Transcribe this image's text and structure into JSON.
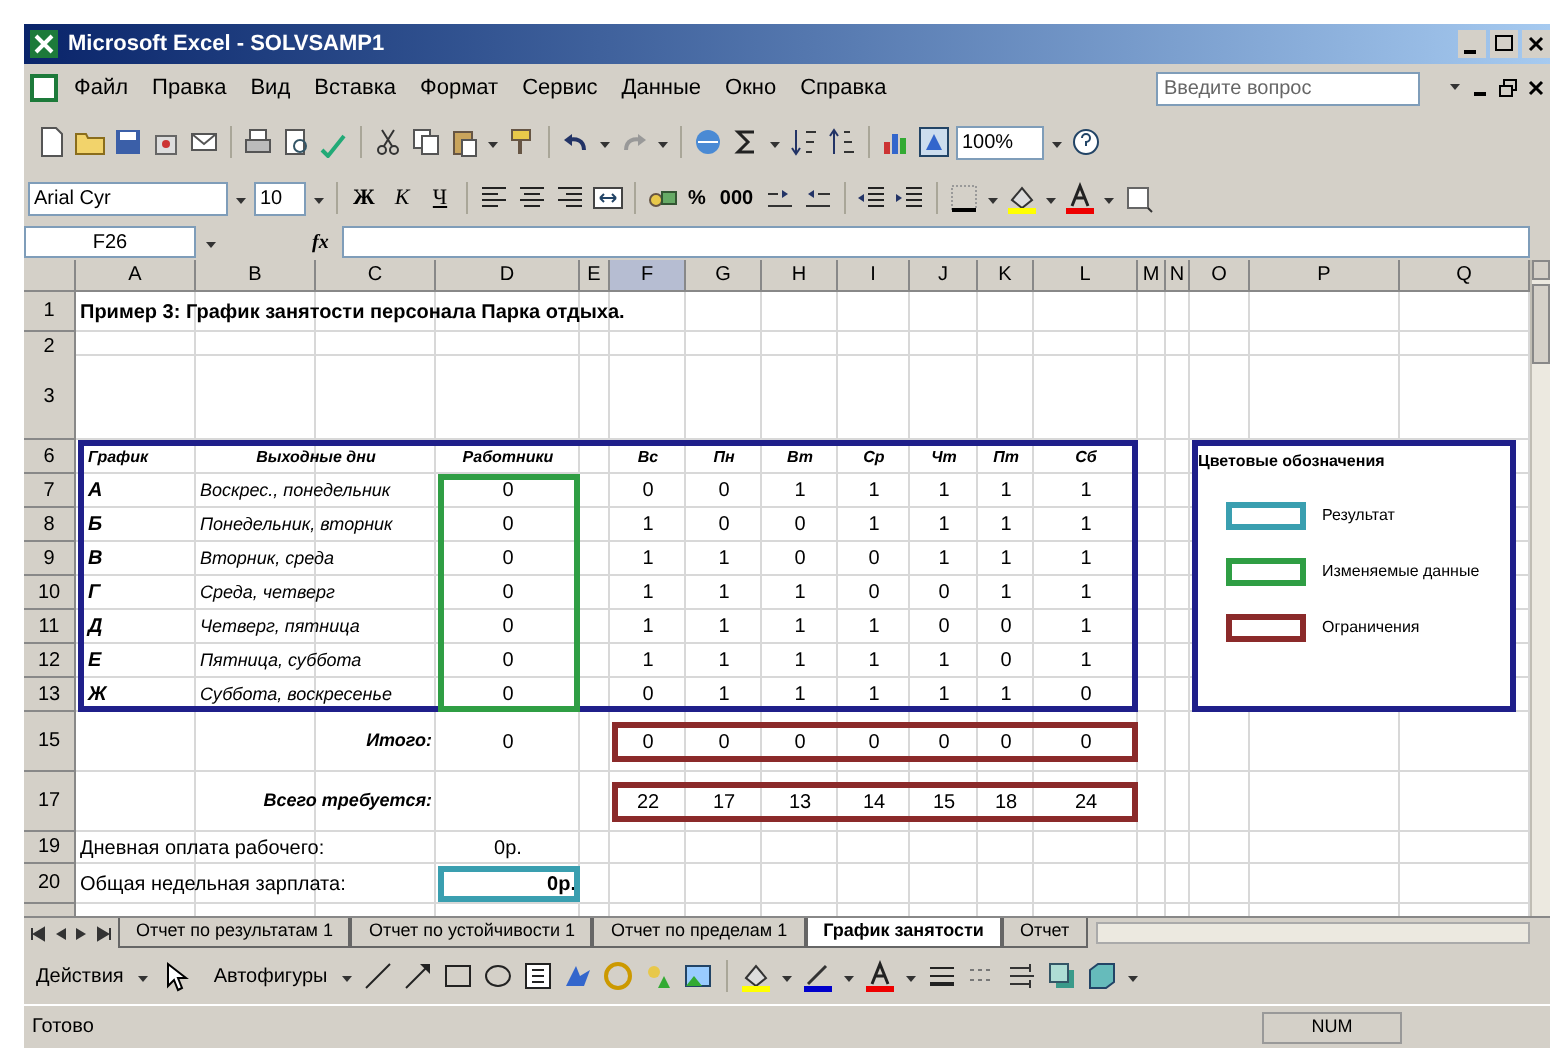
{
  "window": {
    "title": "Microsoft Excel - SOLVSAMP1"
  },
  "menu": [
    "Файл",
    "Правка",
    "Вид",
    "Вставка",
    "Формат",
    "Сервис",
    "Данные",
    "Окно",
    "Справка"
  ],
  "help_search": {
    "placeholder": "Введите вопрос"
  },
  "standard_toolbar": {
    "zoom": "100%"
  },
  "formatting_toolbar": {
    "font": "Arial Cyr",
    "size": "10",
    "style_buttons": [
      "Ж",
      "К",
      "Ч"
    ],
    "number_buttons": [
      "%",
      "000"
    ]
  },
  "formula_bar": {
    "name_box": "F26",
    "function_button": "fx"
  },
  "columns": [
    {
      "label": "A",
      "selected": false
    },
    {
      "label": "B",
      "selected": false
    },
    {
      "label": "C",
      "selected": false
    },
    {
      "label": "D",
      "selected": false
    },
    {
      "label": "E",
      "selected": false
    },
    {
      "label": "F",
      "selected": true
    },
    {
      "label": "G",
      "selected": false
    },
    {
      "label": "H",
      "selected": false
    },
    {
      "label": "I",
      "selected": false
    },
    {
      "label": "J",
      "selected": false
    },
    {
      "label": "K",
      "selected": false
    },
    {
      "label": "L",
      "selected": false
    },
    {
      "label": "M",
      "selected": false
    },
    {
      "label": "N",
      "selected": false
    },
    {
      "label": "O",
      "selected": false
    },
    {
      "label": "P",
      "selected": false
    },
    {
      "label": "Q",
      "selected": false
    }
  ],
  "title_row": {
    "row": "1",
    "text": "Пример 3:  График занятости персонала Парка отдыха."
  },
  "empty_rows": [
    "2",
    "3"
  ],
  "schedule": {
    "header_row": "6",
    "headers": [
      "График",
      "Выходные дни",
      "Работники"
    ],
    "days": [
      "Вс",
      "Пн",
      "Вт",
      "Ср",
      "Чт",
      "Пт",
      "Сб"
    ],
    "rows": [
      {
        "row": "7",
        "schedule": "А",
        "days_off": "Воскрес., понедельник",
        "workers": "0",
        "values": [
          "0",
          "0",
          "1",
          "1",
          "1",
          "1",
          "1"
        ]
      },
      {
        "row": "8",
        "schedule": "Б",
        "days_off": "Понедельник, вторник",
        "workers": "0",
        "values": [
          "1",
          "0",
          "0",
          "1",
          "1",
          "1",
          "1"
        ]
      },
      {
        "row": "9",
        "schedule": "В",
        "days_off": "Вторник, среда",
        "workers": "0",
        "values": [
          "1",
          "1",
          "0",
          "0",
          "1",
          "1",
          "1"
        ]
      },
      {
        "row": "10",
        "schedule": "Г",
        "days_off": "Среда, четверг",
        "workers": "0",
        "values": [
          "1",
          "1",
          "1",
          "0",
          "0",
          "1",
          "1"
        ]
      },
      {
        "row": "11",
        "schedule": "Д",
        "days_off": "Четверг, пятница",
        "workers": "0",
        "values": [
          "1",
          "1",
          "1",
          "1",
          "0",
          "0",
          "1"
        ]
      },
      {
        "row": "12",
        "schedule": "Е",
        "days_off": "Пятница, суббота",
        "workers": "0",
        "values": [
          "1",
          "1",
          "1",
          "1",
          "1",
          "0",
          "1"
        ]
      },
      {
        "row": "13",
        "schedule": "Ж",
        "days_off": "Суббота, воскресенье",
        "workers": "0",
        "values": [
          "0",
          "1",
          "1",
          "1",
          "1",
          "1",
          "0"
        ]
      }
    ]
  },
  "totals": {
    "row": "15",
    "label": "Итого:",
    "workers": "0",
    "values": [
      "0",
      "0",
      "0",
      "0",
      "0",
      "0",
      "0"
    ]
  },
  "required": {
    "row": "17",
    "label": "Всего требуется:",
    "values": [
      "22",
      "17",
      "13",
      "14",
      "15",
      "18",
      "24"
    ]
  },
  "daily_pay": {
    "row": "19",
    "label": "Дневная оплата рабочего:",
    "value": "0р."
  },
  "weekly_pay": {
    "row": "20",
    "label": "Общая недельная зарплата:",
    "value": "0р."
  },
  "legend": {
    "title": "Цветовые обозначения",
    "items": [
      {
        "label": "Результат",
        "color": "#3a9fb0"
      },
      {
        "label": "Изменяемые данные",
        "color": "#2f9e44"
      },
      {
        "label": "Ограничения",
        "color": "#8b2a2a"
      }
    ]
  },
  "sheet_tabs": [
    {
      "label": "Отчет по результатам 1",
      "selected": false
    },
    {
      "label": "Отчет по устойчивости 1",
      "selected": false
    },
    {
      "label": "Отчет по пределам 1",
      "selected": false
    },
    {
      "label": "График занятости",
      "selected": true
    },
    {
      "label": "Отчет",
      "selected": false
    }
  ],
  "drawing_toolbar": {
    "actions": "Действия",
    "autoshapes": "Автофигуры"
  },
  "status_bar": {
    "status": "Готово",
    "num": "NUM"
  }
}
